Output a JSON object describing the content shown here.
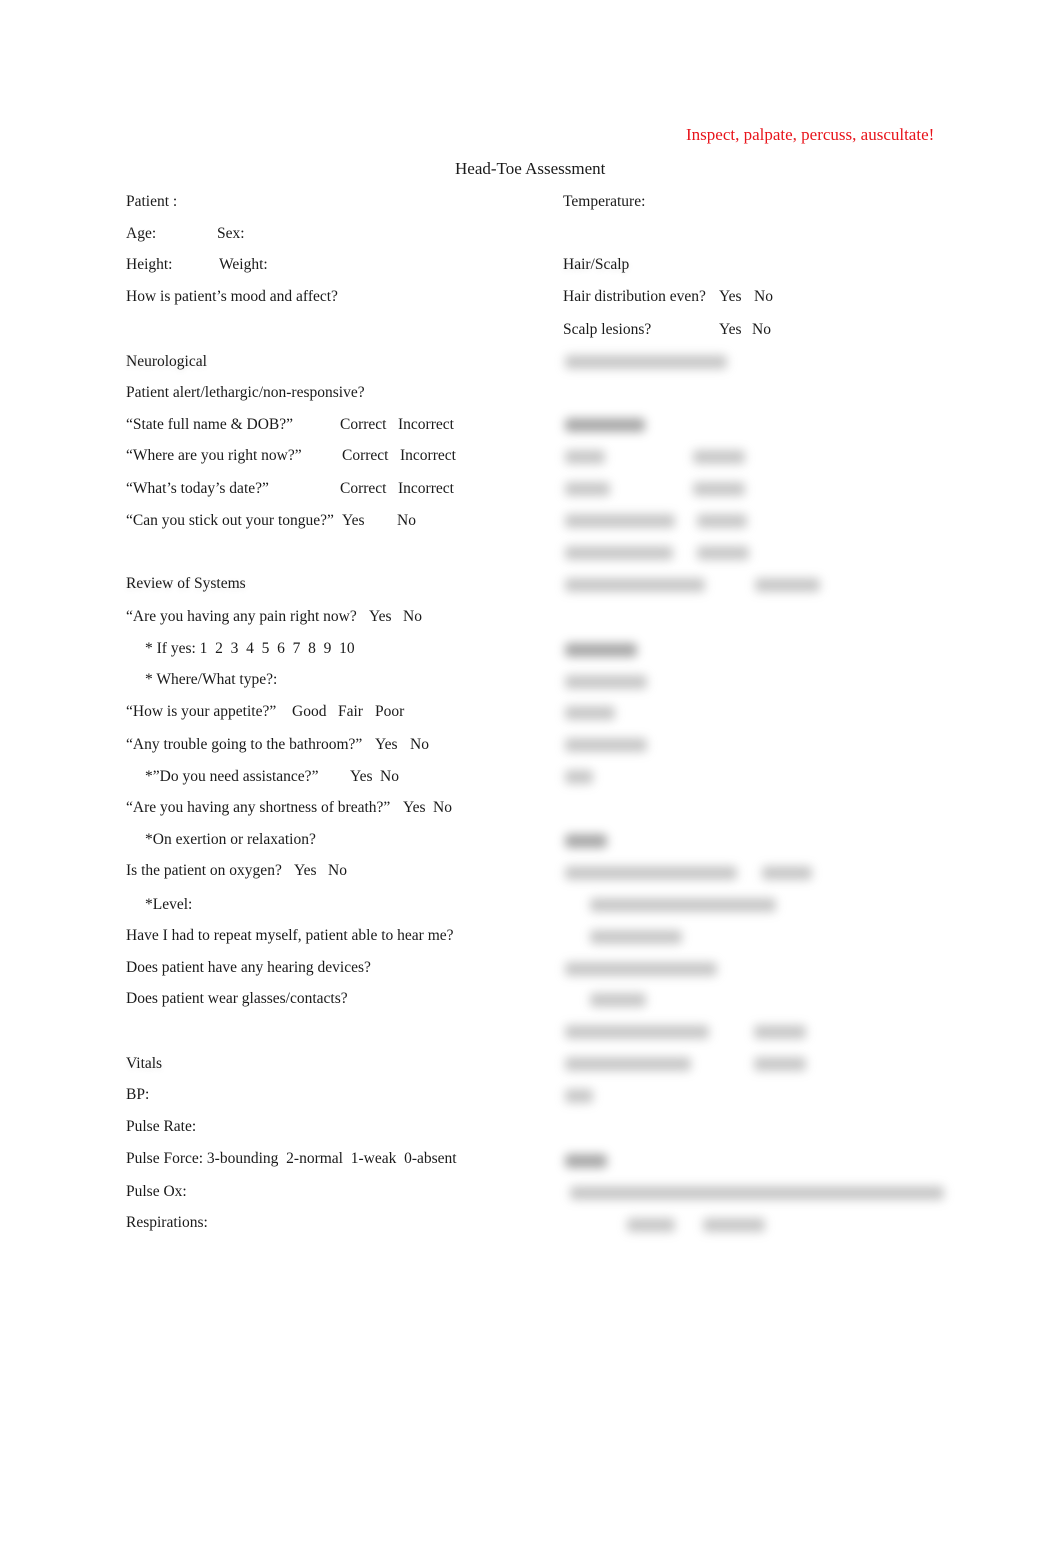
{
  "header": {
    "reminder": "Inspect, palpate, percuss, auscultate!",
    "title": "Head-Toe Assessment"
  },
  "left": {
    "patient": "Patient :",
    "age": "Age:",
    "sex": "Sex:",
    "height": "Height:",
    "weight": "Weight:",
    "mood": "How is patient’s mood and affect?",
    "neuro": {
      "heading": "Neurological",
      "alert": "Patient alert/lethargic/non-responsive?",
      "items": [
        {
          "q": "“State full name & DOB?”",
          "a": "Correct",
          "b": "Incorrect"
        },
        {
          "q": "“Where are you right now?”",
          "a": "Correct",
          "b": "Incorrect"
        },
        {
          "q": "“What’s today’s date?”",
          "a": "Correct",
          "b": "Incorrect"
        },
        {
          "q": "“Can you stick out your tongue?”",
          "a": "Yes",
          "b": "No"
        }
      ]
    },
    "ros": {
      "heading": "Review of Systems",
      "pain": {
        "q": "“Are you having any pain right now?",
        "a": "Yes",
        "b": "No"
      },
      "pain_scale": "* If yes: 1  2  3  4  5  6  7  8  9  10",
      "pain_where": "* Where/What type?:",
      "appetite": {
        "q": "“How is your appetite?”",
        "a": "Good",
        "b": "Fair",
        "c": "Poor"
      },
      "bathroom": {
        "q": "“Any trouble going to the bathroom?”",
        "a": "Yes",
        "b": "No"
      },
      "assist": {
        "q": "*”Do you need assistance?”",
        "a": "Yes",
        "b": "No"
      },
      "sob": {
        "q": "“Are you having any shortness of breath?”",
        "a": "Yes",
        "b": "No"
      },
      "exertion": "*On exertion or relaxation?",
      "oxygen": {
        "q": "Is the patient on oxygen?",
        "a": "Yes",
        "b": "No"
      },
      "level": "*Level:",
      "repeat": "Have I had to repeat myself, patient able to hear me?",
      "hearing": "Does patient have any hearing devices?",
      "glasses": "Does patient wear glasses/contacts?"
    },
    "vitals": {
      "heading": "Vitals",
      "bp": "BP:",
      "pulse_rate": "Pulse Rate:",
      "pulse_force": "Pulse Force: 3-bounding  2-normal  1-weak  0-absent",
      "pulse_ox": "Pulse Ox:",
      "resp": "Respirations:"
    }
  },
  "right": {
    "temperature": "Temperature:",
    "hair": {
      "heading": "Hair/Scalp",
      "dist": {
        "q": "Hair distribution even?",
        "a": "Yes",
        "b": "No"
      },
      "lesions": {
        "q": "Scalp lesions?",
        "a": "Yes",
        "b": "No"
      }
    }
  }
}
